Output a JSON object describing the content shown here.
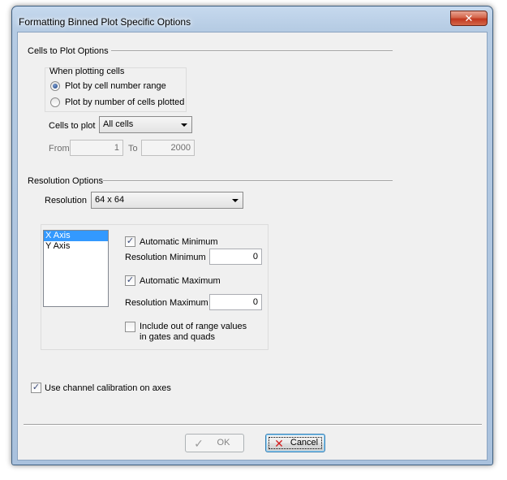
{
  "window": {
    "title": "Formatting Binned Plot Specific Options",
    "close_glyph": "✕"
  },
  "cells_to_plot": {
    "heading": "Cells to Plot Options",
    "when_plotting_label": "When plotting cells",
    "radio_range_label": "Plot by cell number range",
    "radio_count_label": "Plot by number of cells plotted",
    "selected_mode": "range",
    "cells_to_plot_label": "Cells to plot",
    "cells_to_plot_value": "All cells",
    "from_label": "From",
    "from_value": "1",
    "to_label": "To",
    "to_value": "2000"
  },
  "resolution": {
    "heading": "Resolution Options",
    "resolution_label": "Resolution",
    "resolution_value": "64 x 64",
    "axes": [
      "X Axis",
      "Y Axis"
    ],
    "selected_axis": "X Axis",
    "auto_min_label": "Automatic Minimum",
    "auto_min_checked": true,
    "res_min_label": "Resolution Minimum",
    "res_min_value": "0",
    "auto_max_label": "Automatic Maximum",
    "auto_max_checked": true,
    "res_max_label": "Resolution Maximum",
    "res_max_value": "0",
    "include_out_of_range_line1": "Include out of range values",
    "include_out_of_range_line2": "in gates and quads",
    "include_out_of_range_checked": false
  },
  "calibration": {
    "label": "Use channel calibration on axes",
    "checked": true
  },
  "buttons": {
    "ok_label": "OK",
    "ok_icon": "✓",
    "cancel_label": "Cancel",
    "cancel_icon": "✕"
  },
  "colors": {
    "cancel_icon": "#d21e1e",
    "ok_icon_disabled": "#9a9a9a",
    "list_selection": "#3399ff"
  }
}
